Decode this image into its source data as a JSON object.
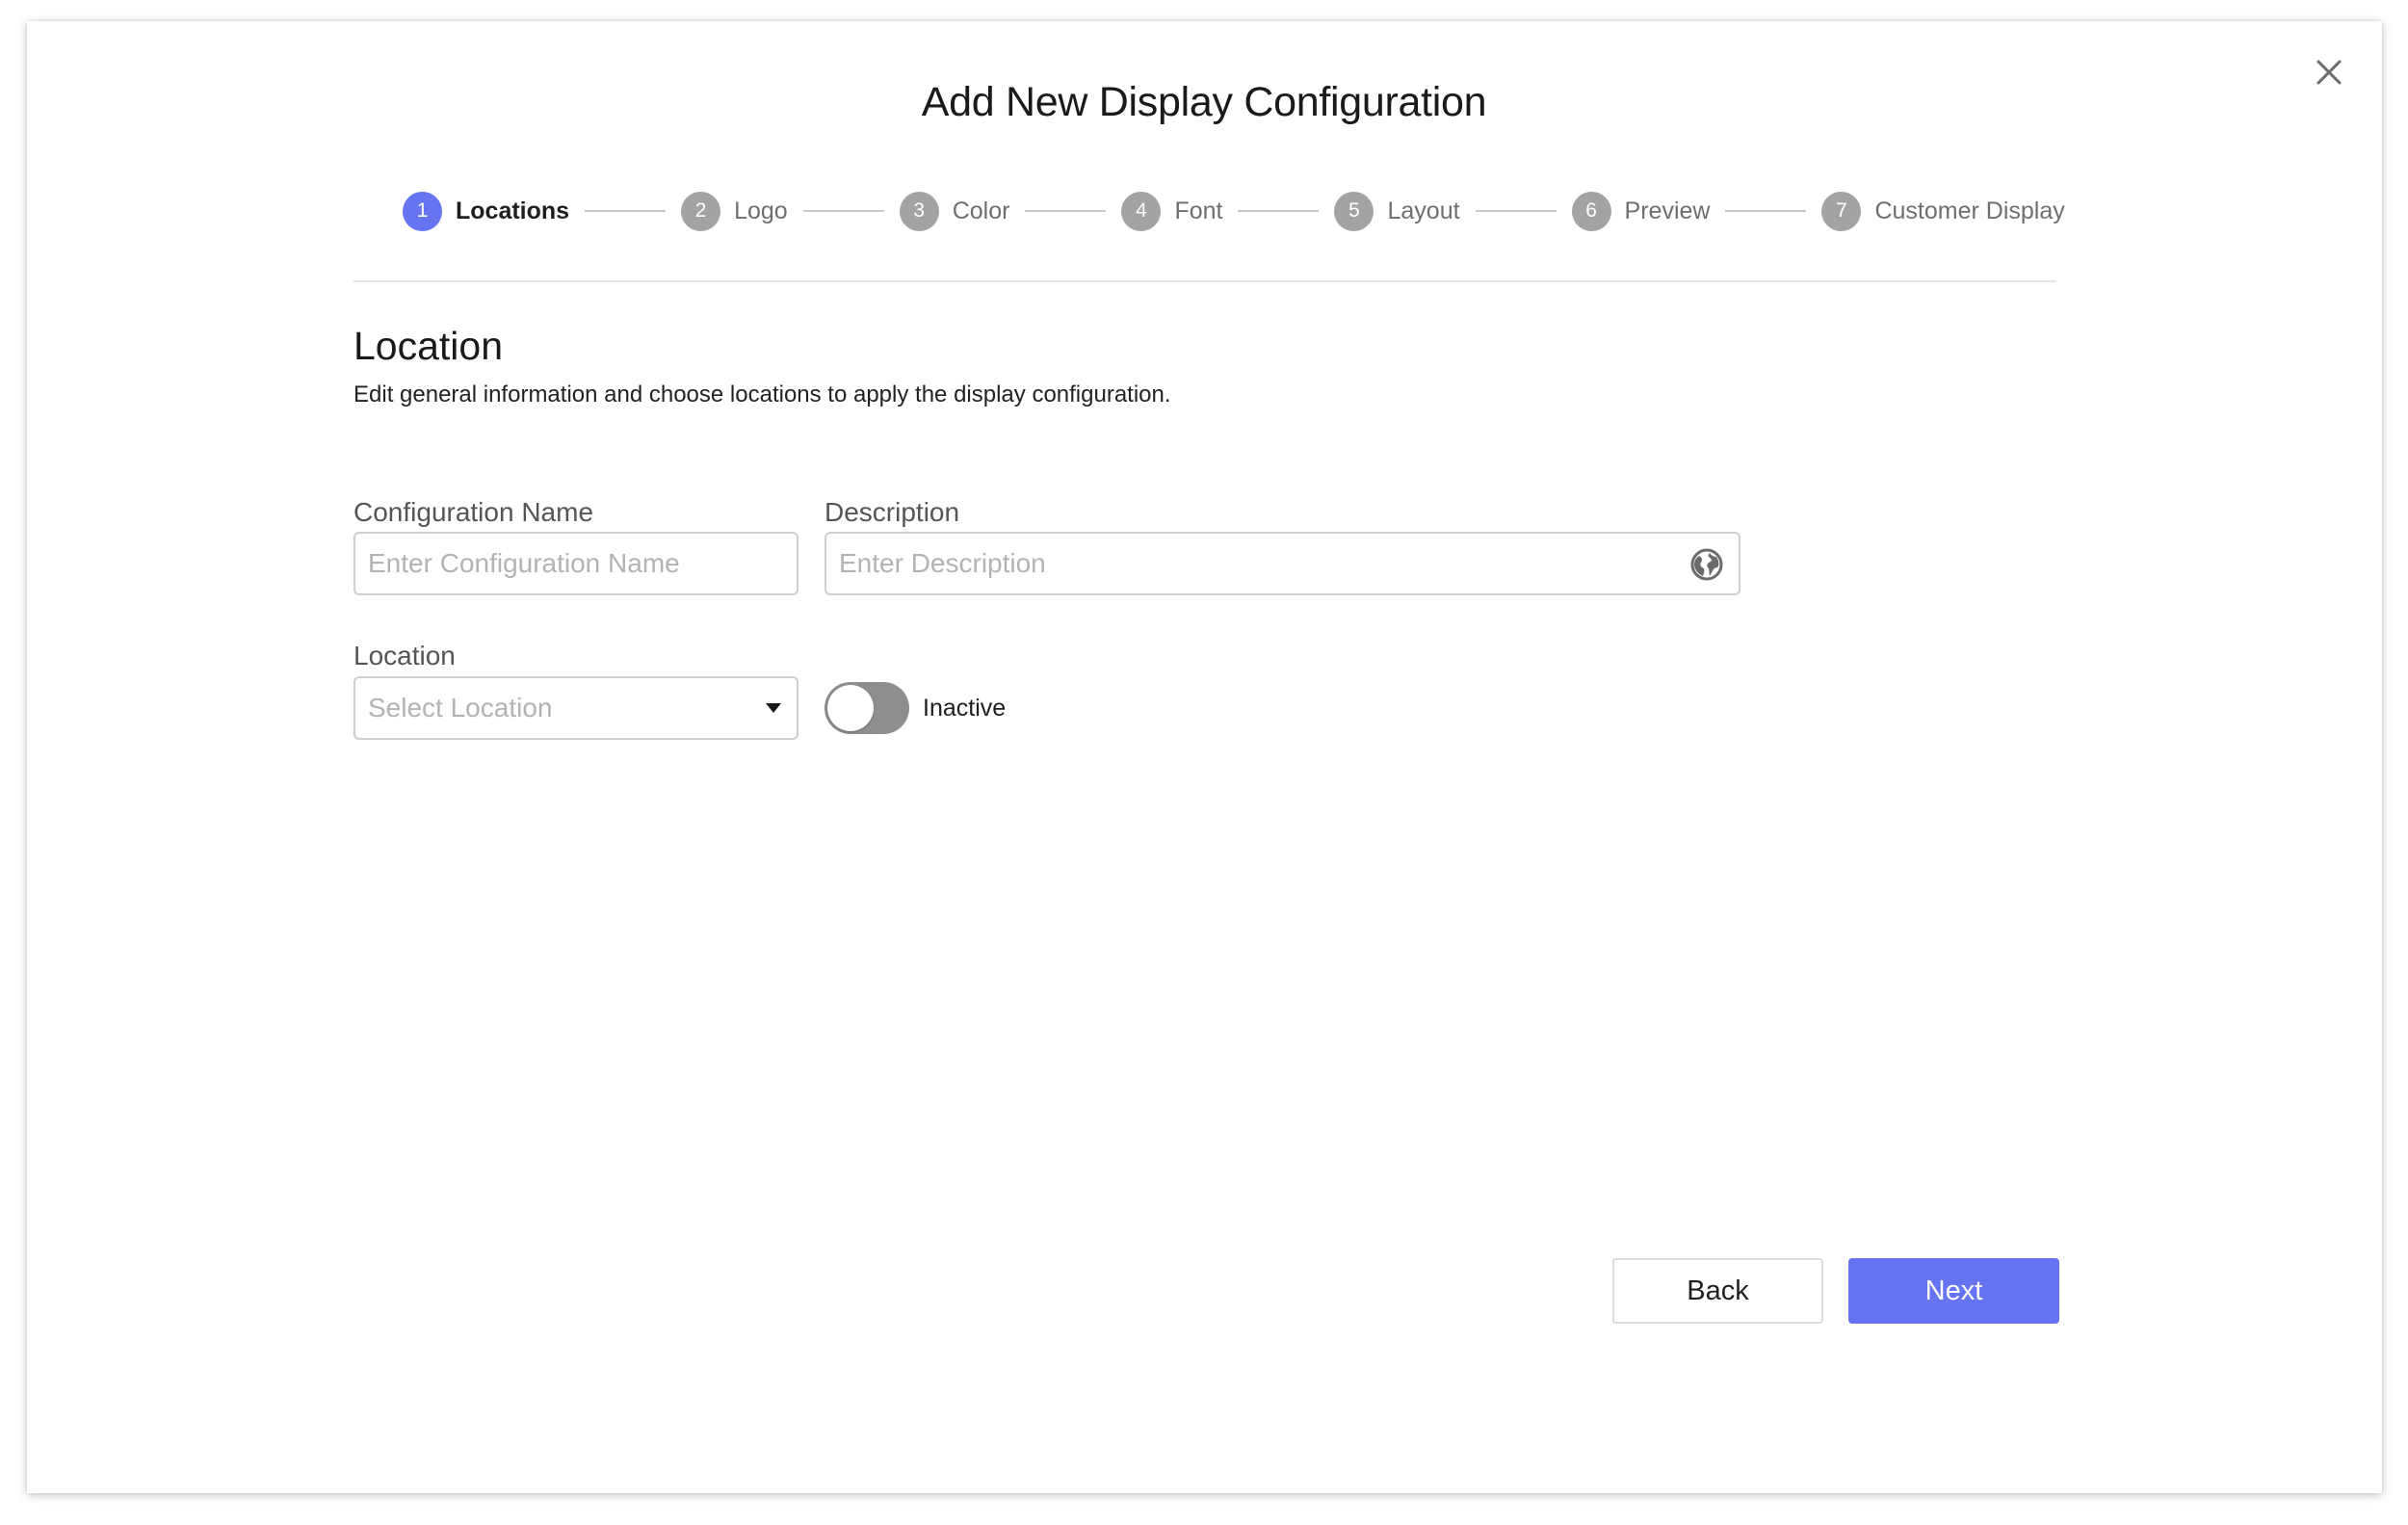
{
  "modal": {
    "title": "Add New Display Configuration"
  },
  "stepper": {
    "steps": [
      {
        "number": "1",
        "label": "Locations",
        "active": true
      },
      {
        "number": "2",
        "label": "Logo",
        "active": false
      },
      {
        "number": "3",
        "label": "Color",
        "active": false
      },
      {
        "number": "4",
        "label": "Font",
        "active": false
      },
      {
        "number": "5",
        "label": "Layout",
        "active": false
      },
      {
        "number": "6",
        "label": "Preview",
        "active": false
      },
      {
        "number": "7",
        "label": "Customer Display",
        "active": false
      }
    ]
  },
  "section": {
    "title": "Location",
    "description": "Edit general information and choose locations to apply the display configuration."
  },
  "form": {
    "config_name": {
      "label": "Configuration Name",
      "placeholder": "Enter Configuration Name",
      "value": ""
    },
    "description": {
      "label": "Description",
      "placeholder": "Enter Description",
      "value": "",
      "icon": "globe-icon"
    },
    "location": {
      "label": "Location",
      "placeholder": "Select Location",
      "icon": "caret-down-icon"
    },
    "status_toggle": {
      "label": "Inactive",
      "on": false
    }
  },
  "footer": {
    "back_label": "Back",
    "next_label": "Next"
  },
  "colors": {
    "accent": "#6674f2",
    "step_inactive": "#a3a3a3",
    "toggle_off": "#8e8e8e",
    "border": "#cfcfcf"
  }
}
